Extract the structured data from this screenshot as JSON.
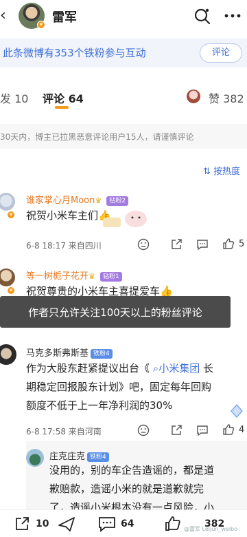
{
  "header": {
    "title": "雷军",
    "verified_badge": "v"
  },
  "banner": {
    "text": "此条微博有353个铁粉参与互动",
    "button": "评论"
  },
  "tabs": {
    "repost": "发 10",
    "comment": "评论 64",
    "like": "赞 382"
  },
  "notice": "30天内，博主已拉黑恶意评论用户15人，请谨慎评论",
  "sort_label": "按热度",
  "comments": [
    {
      "name": "谁家掌心月Moon",
      "badge": "钻粉2",
      "text": "祝贺小米车主们👍",
      "meta": "6-8 18:17  来自四川",
      "share": "",
      "reply": "",
      "likes": "5"
    },
    {
      "name": "等一树栀子花开",
      "badge": "钻粉1",
      "text": "祝贺尊贵的小米车主喜提爱车👍"
    },
    {
      "name": "马克多斯弗斯基",
      "badge": "铁粉4",
      "text_line1": "作为大股东赶紧提议出台《 ",
      "link": "小米集团",
      "text_line1b": " 长",
      "text_line2": "期稳定回报股东计划》吧，固定每年回购",
      "text_line3": "额度不低于上一年净利润的30%",
      "meta": "6-8 17:58  来自河南",
      "likes": "4"
    }
  ],
  "reply": {
    "name": "庄克庄克",
    "badge": "铁粉4",
    "line1": "没用的，别的车企告造谣的，都是道",
    "line2": "歉赔款，造谣小米的就是道歉就完",
    "line3": "了，造谣小米根本没有一点风险，小"
  },
  "toast": "作者只允许关注100天以上的粉丝评论",
  "bottom_bar": {
    "repost_count": "10",
    "comment_count": "64",
    "like_count": "382"
  },
  "watermark": "@雷军 Leijun_weibo",
  "colors": {
    "accent_orange": "#f39a1c",
    "link_blue": "#3f6fd6",
    "name_orange": "#e8771e"
  }
}
